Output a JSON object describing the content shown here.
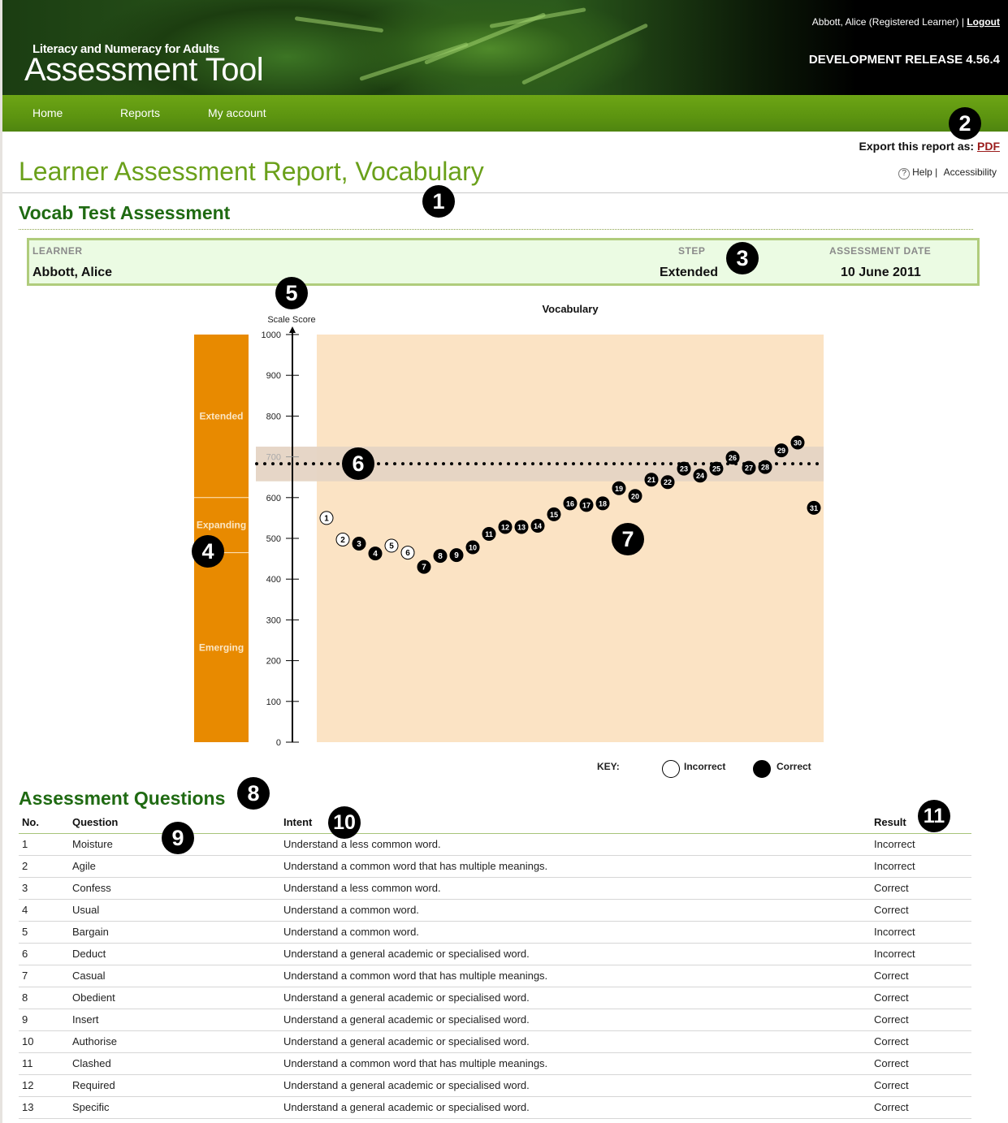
{
  "header": {
    "logo_subtitle": "Literacy and Numeracy for Adults",
    "logo_title": "Assessment Tool",
    "user": "Abbott, Alice (Registered Learner)",
    "separator": "|",
    "logout": "Logout",
    "release": "DEVELOPMENT RELEASE 4.56.4"
  },
  "nav": {
    "items": [
      {
        "label": "Home"
      },
      {
        "label": "Reports"
      },
      {
        "label": "My account"
      }
    ]
  },
  "export": {
    "label": "Export this report as:",
    "pdf": "PDF"
  },
  "help": {
    "icon": "question-icon",
    "icon_glyph": "?",
    "help": "Help",
    "separator": "|",
    "accessibility": "Accessibility"
  },
  "page": {
    "title": "Learner Assessment Report, Vocabulary",
    "section_title": "Vocab Test Assessment"
  },
  "info": {
    "learner_label": "LEARNER",
    "learner": "Abbott, Alice",
    "step_label": "STEP",
    "step": "Extended",
    "date_label": "ASSESSMENT DATE",
    "date": "10 June 2011"
  },
  "callouts": [
    "1",
    "2",
    "3",
    "4",
    "5",
    "6",
    "7",
    "8",
    "9",
    "10",
    "11"
  ],
  "colors": {
    "step_bar": "#e88a00",
    "plot_bg": "#fbe3c4",
    "band": "#e5d4c4",
    "green_title": "#6aa01a",
    "dark_green": "#1f6a12",
    "incorrect": "#a01818",
    "correct": "#2a8a2a"
  },
  "chart_data": {
    "type": "scatter",
    "title": "Vocabulary",
    "ylabel": "Scale Score",
    "xlabel": "",
    "ylim": [
      0,
      1000
    ],
    "yticks": [
      0,
      100,
      200,
      300,
      400,
      500,
      600,
      700,
      800,
      900,
      1000
    ],
    "grid": false,
    "steps": [
      {
        "name": "Extended",
        "from": 600,
        "to": 1000
      },
      {
        "name": "Expanding",
        "from": 465,
        "to": 600
      },
      {
        "name": "Emerging",
        "from": 0,
        "to": 465
      }
    ],
    "final_score": 683,
    "score_band": [
      640,
      725
    ],
    "points": [
      {
        "q": 1,
        "score": 550,
        "correct": false
      },
      {
        "q": 2,
        "score": 497,
        "correct": false
      },
      {
        "q": 3,
        "score": 487,
        "correct": true
      },
      {
        "q": 4,
        "score": 463,
        "correct": true
      },
      {
        "q": 5,
        "score": 482,
        "correct": false
      },
      {
        "q": 6,
        "score": 465,
        "correct": false
      },
      {
        "q": 7,
        "score": 430,
        "correct": true
      },
      {
        "q": 8,
        "score": 457,
        "correct": true
      },
      {
        "q": 9,
        "score": 459,
        "correct": true
      },
      {
        "q": 10,
        "score": 478,
        "correct": true
      },
      {
        "q": 11,
        "score": 511,
        "correct": true
      },
      {
        "q": 12,
        "score": 528,
        "correct": true
      },
      {
        "q": 13,
        "score": 528,
        "correct": true
      },
      {
        "q": 14,
        "score": 531,
        "correct": true
      },
      {
        "q": 15,
        "score": 559,
        "correct": true
      },
      {
        "q": 16,
        "score": 586,
        "correct": true
      },
      {
        "q": 17,
        "score": 582,
        "correct": true
      },
      {
        "q": 18,
        "score": 586,
        "correct": true
      },
      {
        "q": 19,
        "score": 623,
        "correct": true
      },
      {
        "q": 20,
        "score": 604,
        "correct": true
      },
      {
        "q": 21,
        "score": 644,
        "correct": true
      },
      {
        "q": 22,
        "score": 638,
        "correct": true
      },
      {
        "q": 23,
        "score": 671,
        "correct": true
      },
      {
        "q": 24,
        "score": 654,
        "correct": true
      },
      {
        "q": 25,
        "score": 671,
        "correct": true
      },
      {
        "q": 26,
        "score": 698,
        "correct": true
      },
      {
        "q": 27,
        "score": 673,
        "correct": true
      },
      {
        "q": 28,
        "score": 675,
        "correct": true
      },
      {
        "q": 29,
        "score": 716,
        "correct": true
      },
      {
        "q": 30,
        "score": 735,
        "correct": true
      },
      {
        "q": 31,
        "score": 575,
        "correct": true
      }
    ],
    "legend": {
      "label": "KEY:",
      "placement": "bottom-right",
      "items": [
        {
          "name": "Incorrect",
          "filled": false
        },
        {
          "name": "Correct",
          "filled": true
        }
      ]
    }
  },
  "questions": {
    "title": "Assessment Questions",
    "columns": [
      "No.",
      "Question",
      "Intent",
      "Result"
    ],
    "rows": [
      {
        "no": "1",
        "question": "Moisture",
        "intent": "Understand a less common word.",
        "result": "Incorrect"
      },
      {
        "no": "2",
        "question": "Agile",
        "intent": "Understand a common word that has multiple meanings.",
        "result": "Incorrect"
      },
      {
        "no": "3",
        "question": "Confess",
        "intent": "Understand a less common word.",
        "result": "Correct"
      },
      {
        "no": "4",
        "question": "Usual",
        "intent": "Understand a common word.",
        "result": "Correct"
      },
      {
        "no": "5",
        "question": "Bargain",
        "intent": "Understand a common word.",
        "result": "Incorrect"
      },
      {
        "no": "6",
        "question": "Deduct",
        "intent": "Understand a general academic or specialised word.",
        "result": "Incorrect"
      },
      {
        "no": "7",
        "question": "Casual",
        "intent": "Understand a common word that has multiple meanings.",
        "result": "Correct"
      },
      {
        "no": "8",
        "question": "Obedient",
        "intent": "Understand a general academic or specialised word.",
        "result": "Correct"
      },
      {
        "no": "9",
        "question": "Insert",
        "intent": "Understand a general academic or specialised word.",
        "result": "Correct"
      },
      {
        "no": "10",
        "question": "Authorise",
        "intent": "Understand a general academic or specialised word.",
        "result": "Correct"
      },
      {
        "no": "11",
        "question": "Clashed",
        "intent": "Understand a common word that has multiple meanings.",
        "result": "Correct"
      },
      {
        "no": "12",
        "question": "Required",
        "intent": "Understand a general academic or specialised word.",
        "result": "Correct"
      },
      {
        "no": "13",
        "question": "Specific",
        "intent": "Understand a general academic or specialised word.",
        "result": "Correct"
      }
    ]
  }
}
